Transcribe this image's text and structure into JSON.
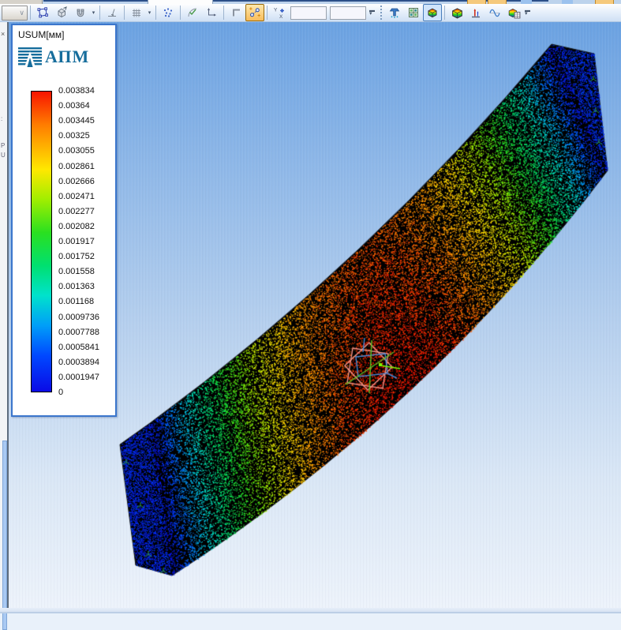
{
  "toolbar": {
    "combo_value": "",
    "icons_left": [
      "sketch-polygon",
      "extrude",
      "magnet",
      "perpendicular",
      "grid",
      "scatter-points",
      "angle-check",
      "axes-arrow",
      "corner",
      "measure-points",
      "yx-coordinates"
    ],
    "coord_input_1": "",
    "coord_input_2": "",
    "icons_right": [
      "solve",
      "matrix",
      "results-map",
      "rainbow-cube",
      "reactions",
      "mode-curve",
      "results-table"
    ],
    "pressed_buttons": [
      "measure-points",
      "results-map"
    ]
  },
  "left_panel": {
    "close_glyph": "×",
    "fragments": [
      ":",
      "P",
      "U"
    ]
  },
  "legend": {
    "title": "USUM[мм]",
    "logo_text": "АПМ",
    "values": [
      "0.003834",
      "0.00364",
      "0.003445",
      "0.00325",
      "0.003055",
      "0.002861",
      "0.002666",
      "0.002471",
      "0.002277",
      "0.002082",
      "0.001917",
      "0.001752",
      "0.001558",
      "0.001363",
      "0.001168",
      "0.0009736",
      "0.0007788",
      "0.0005841",
      "0.0003894",
      "0.0001947",
      "0"
    ],
    "colorbar_stops": [
      {
        "p": 0.0,
        "c": "#f81400"
      },
      {
        "p": 0.11,
        "c": "#ff7c00"
      },
      {
        "p": 0.26,
        "c": "#ffe800"
      },
      {
        "p": 0.36,
        "c": "#a0ee00"
      },
      {
        "p": 0.47,
        "c": "#2ae020"
      },
      {
        "p": 0.58,
        "c": "#00e070"
      },
      {
        "p": 0.68,
        "c": "#00e2cc"
      },
      {
        "p": 0.78,
        "c": "#009ef8"
      },
      {
        "p": 0.88,
        "c": "#0048ff"
      },
      {
        "p": 1.0,
        "c": "#0a0ae6"
      }
    ]
  },
  "scene": {
    "background_top": "#6ba2e2",
    "background_bottom": "#edf3fb",
    "beam_base_color": "#000000",
    "support_marker_color": "#2f9e2f",
    "csys_marker": {
      "salmon": "#f2948a",
      "blue": "#4489d8",
      "green": "#58c424",
      "bright_green": "#7cfc00"
    }
  }
}
